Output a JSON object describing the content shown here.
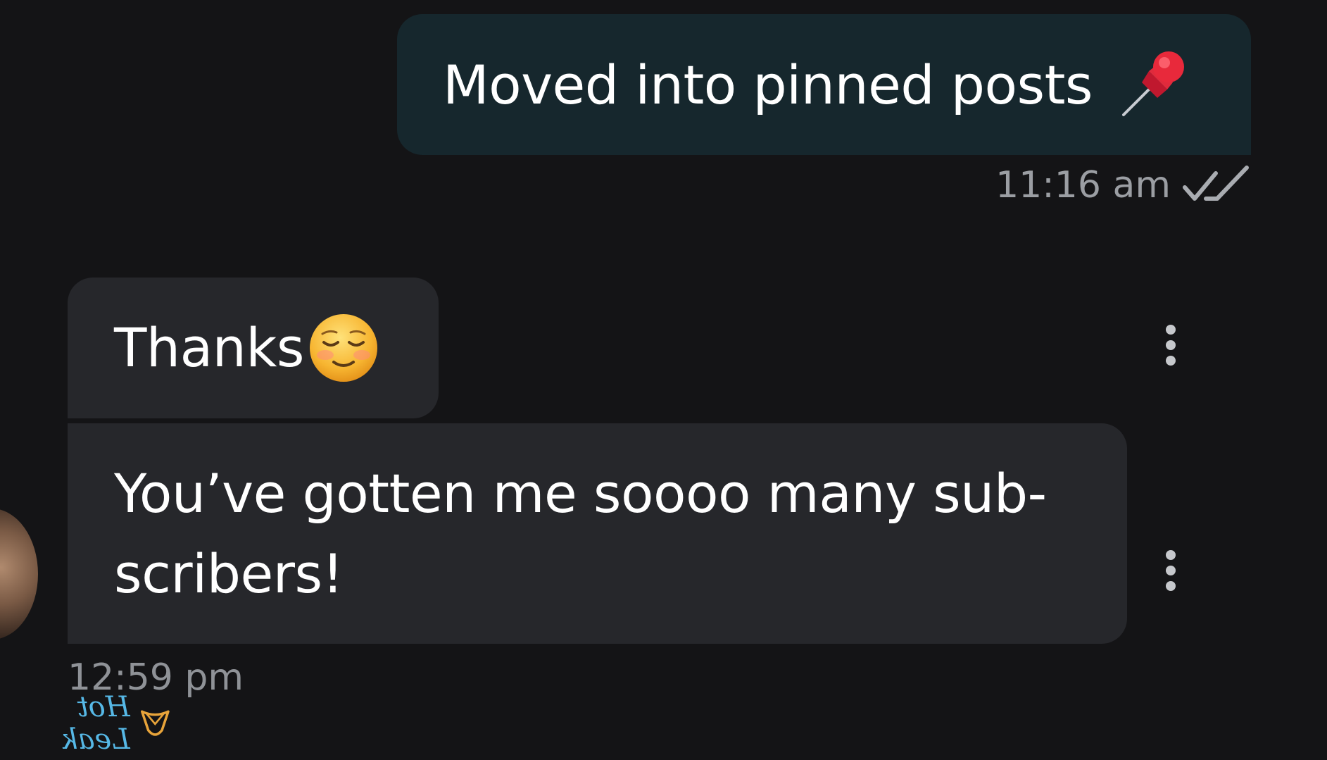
{
  "messages": {
    "outgoing": {
      "text": "Moved into pinned posts",
      "emoji_icon": "pushpin-icon",
      "time": "11:16 am",
      "status_icon": "double-check-icon"
    },
    "incoming_first": {
      "text": "Thanks",
      "emoji_icon": "smiling-face-icon"
    },
    "incoming_second": {
      "text": "You’ve gotten me soooo many sub- scribers!"
    },
    "incoming_time": "12:59 pm"
  },
  "watermark": {
    "text": "Hot Leak"
  },
  "colors": {
    "background": "#141416",
    "outgoing_bubble": "#16272d",
    "incoming_bubble": "#26272b",
    "timestamp": "#9b9ea3",
    "watermark": "#56b8e6"
  }
}
